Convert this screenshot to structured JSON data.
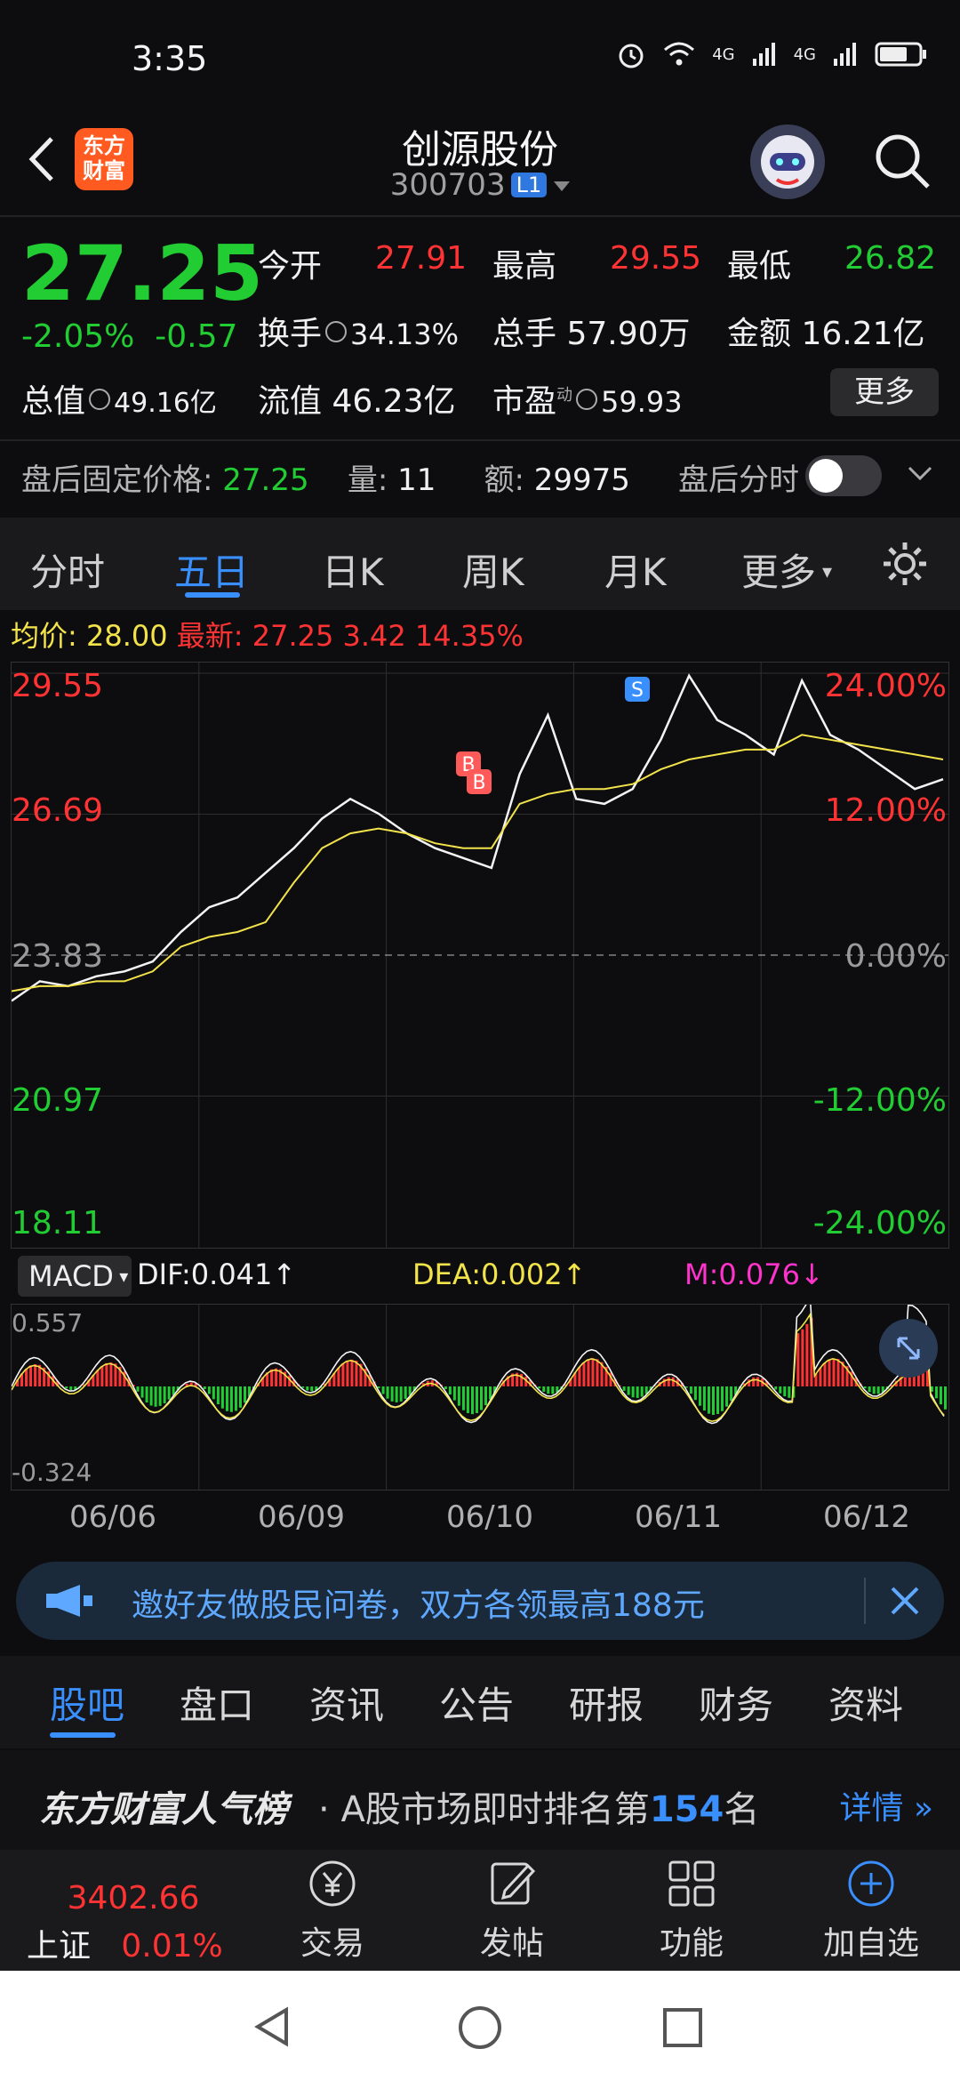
{
  "status_bar": {
    "time": "3:35",
    "net1": "4G",
    "net2": "4G"
  },
  "header": {
    "logo_text": "东方\n财富",
    "title": "创源股份",
    "code": "300703",
    "level": "L1"
  },
  "quote": {
    "price": "27.25",
    "change_pct": "-2.05%",
    "change_abs": "-0.57",
    "open_label": "今开",
    "open": "27.91",
    "high_label": "最高",
    "high": "29.55",
    "low_label": "最低",
    "low": "26.82",
    "turnover_label": "换手",
    "turnover": "34.13%",
    "volume_label": "总手",
    "volume": "57.90万",
    "amount_label": "金额",
    "amount": "16.21亿",
    "mktcap_label": "总值",
    "mktcap": "49.16亿",
    "float_label": "流值",
    "float": "46.23亿",
    "pe_label": "市盈",
    "pe_sup": "动",
    "pe": "59.93",
    "more": "更多"
  },
  "after_hours": {
    "price_label": "盘后固定价格:",
    "price": "27.25",
    "vol_label": "量:",
    "vol": "11",
    "amt_label": "额:",
    "amt": "29975",
    "timeshare_label": "盘后分时"
  },
  "tabs": [
    "分时",
    "五日",
    "日K",
    "周K",
    "月K",
    "更多"
  ],
  "active_tab": "五日",
  "avg_line": {
    "avg_label": "均价:",
    "avg": "28.00",
    "latest_label": "最新:",
    "latest": "27.25",
    "chg": "3.42",
    "pct": "14.35%"
  },
  "chart_data": {
    "type": "line",
    "y_left_labels": [
      "29.55",
      "26.69",
      "23.83",
      "20.97",
      "18.11"
    ],
    "y_right_labels": [
      "24.00%",
      "12.00%",
      "0.00%",
      "-12.00%",
      "-24.00%"
    ],
    "ylim": [
      18.11,
      29.55
    ],
    "baseline": 23.83,
    "x_dates": [
      "06/06",
      "06/09",
      "06/10",
      "06/11",
      "06/12"
    ],
    "series": [
      {
        "values": [
          22.9,
          23.3,
          23.2,
          23.4,
          23.5,
          23.7,
          24.3,
          24.8,
          25.0,
          25.5,
          26.0,
          26.6,
          27.0,
          26.7,
          26.3,
          26.0,
          25.8,
          25.6,
          27.5,
          28.7,
          27.0,
          26.9,
          27.2,
          28.2,
          29.5,
          28.6,
          28.3,
          27.9,
          29.4,
          28.3,
          28.0,
          27.6,
          27.2,
          27.4
        ]
      },
      {
        "values": [
          23.1,
          23.2,
          23.2,
          23.3,
          23.3,
          23.5,
          24.0,
          24.2,
          24.3,
          24.5,
          25.3,
          26.0,
          26.3,
          26.4,
          26.3,
          26.1,
          26.0,
          26.0,
          26.9,
          27.1,
          27.2,
          27.2,
          27.3,
          27.6,
          27.8,
          27.9,
          28.0,
          28.0,
          28.3,
          28.2,
          28.1,
          28.0,
          27.9,
          27.8
        ]
      }
    ],
    "markers": [
      "B",
      "B",
      "S"
    ]
  },
  "macd": {
    "selector": "MACD",
    "dif": "DIF:0.041",
    "dea": "DEA:0.002",
    "m": "M:0.076",
    "top": "0.557",
    "bottom": "-0.324"
  },
  "banner": {
    "text": "邀好友做股民问卷，双方各领最高188元"
  },
  "subtabs": [
    "股吧",
    "盘口",
    "资讯",
    "公告",
    "研报",
    "财务",
    "资料"
  ],
  "rank": {
    "title": "东方财富人气榜",
    "sep": "·",
    "prefix": "A股市场即时排名第",
    "num": "154",
    "suffix": "名",
    "detail": "详情"
  },
  "bottom_nav": {
    "index_value": "3402.66",
    "index_name": "上证",
    "index_pct": "0.01%",
    "trade": "交易",
    "post": "发帖",
    "func": "功能",
    "add": "加自选"
  },
  "colors": {
    "up": "#ff3333",
    "down": "#22cc33",
    "accent": "#3a8fff",
    "avg_line": "#f2e34a"
  }
}
